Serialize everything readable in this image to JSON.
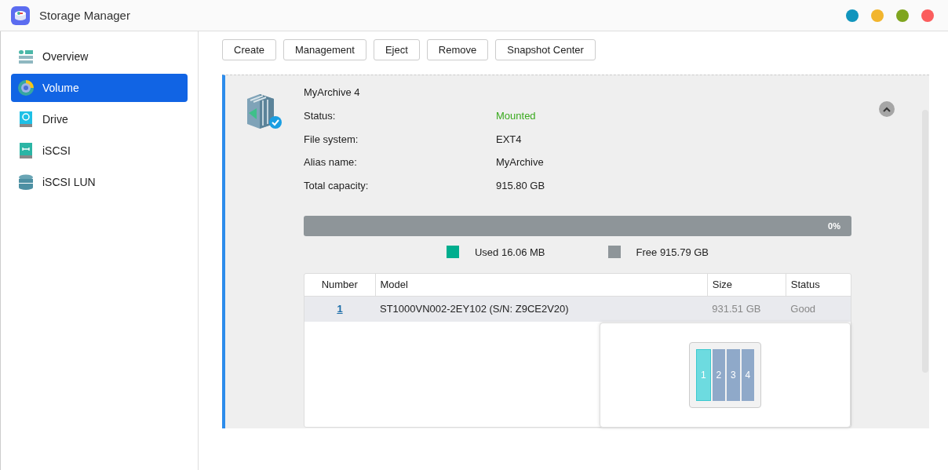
{
  "window": {
    "title": "Storage Manager"
  },
  "sidebar": {
    "items": [
      {
        "label": "Overview",
        "kind": "overview",
        "selected": false
      },
      {
        "label": "Volume",
        "kind": "volume",
        "selected": true
      },
      {
        "label": "Drive",
        "kind": "drive",
        "selected": false
      },
      {
        "label": "iSCSI",
        "kind": "iscsi",
        "selected": false
      },
      {
        "label": "iSCSI LUN",
        "kind": "lun",
        "selected": false
      }
    ]
  },
  "toolbar": {
    "buttons": [
      "Create",
      "Management",
      "Eject",
      "Remove",
      "Snapshot Center"
    ]
  },
  "volume": {
    "name": "MyArchive 4",
    "expanded": true,
    "fields": [
      {
        "label": "Status:",
        "value": "Mounted",
        "kind": "status"
      },
      {
        "label": "File system:",
        "value": "EXT4",
        "kind": "plain"
      },
      {
        "label": "Alias name:",
        "value": "MyArchive",
        "kind": "plain"
      },
      {
        "label": "Total capacity:",
        "value": "915.80 GB",
        "kind": "plain"
      }
    ],
    "usage": {
      "level": 0,
      "reading": "0%"
    },
    "legend": [
      {
        "label": "Used 16.06 MB",
        "color": "#00ae8e"
      },
      {
        "label": "Free 915.79 GB",
        "color": "#8e9599"
      }
    ]
  },
  "table": {
    "columns": [
      "Number",
      "Model",
      "Size",
      "Status"
    ],
    "rows": [
      {
        "number": "1",
        "model": "ST1000VN002-2EY102 (S/N: Z9CE2V20)",
        "size": "931.51 GB",
        "status": "Good",
        "selected": true
      }
    ]
  },
  "bay_popup": {
    "slots": [
      {
        "label": "1",
        "selected": true
      },
      {
        "label": "2",
        "selected": false
      },
      {
        "label": "3",
        "selected": false
      },
      {
        "label": "4",
        "selected": false
      }
    ]
  }
}
